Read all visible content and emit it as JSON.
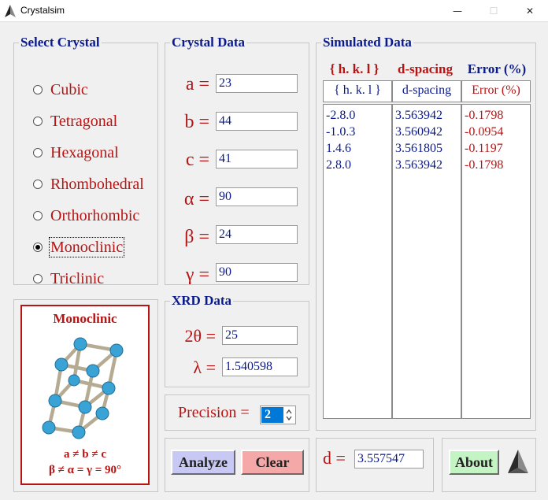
{
  "window": {
    "title": "Crystalsim",
    "minimize_glyph": "—",
    "maximize_glyph": "☐",
    "close_glyph": "✕"
  },
  "select_crystal": {
    "legend": "Select Crystal",
    "options": [
      "Cubic",
      "Tetragonal",
      "Hexagonal",
      "Rhombohedral",
      "Orthorhombic",
      "Monoclinic",
      "Triclinic"
    ],
    "selected": "Monoclinic"
  },
  "crystal_data": {
    "legend": "Crystal Data",
    "params": [
      {
        "label": "a =",
        "value": "23"
      },
      {
        "label": "b =",
        "value": "44"
      },
      {
        "label": "c =",
        "value": "41"
      },
      {
        "label": "α =",
        "value": "90"
      },
      {
        "label": "β =",
        "value": "24"
      },
      {
        "label": "γ =",
        "value": "90"
      }
    ]
  },
  "xrd_data": {
    "legend": "XRD Data",
    "two_theta_label": "2θ =",
    "two_theta_value": "25",
    "lambda_label": "λ =",
    "lambda_value": "1.540598"
  },
  "precision": {
    "label": "Precision =",
    "value": "2"
  },
  "buttons": {
    "analyze": "Analyze",
    "clear": "Clear",
    "about": "About"
  },
  "d_output": {
    "label": "d =",
    "value": "3.557547"
  },
  "preview": {
    "title": "Monoclinic",
    "line1": "a ≠ b ≠ c",
    "line2": "β ≠ α = γ = 90°"
  },
  "simulated_data": {
    "legend": "Simulated Data",
    "headers": [
      "{ h. k. l }",
      "d-spacing",
      "Error (%)"
    ],
    "subheaders": [
      "{ h. k. l }",
      "d-spacing",
      "Error (%)"
    ],
    "rows": [
      {
        "hkl": "-2.8.0",
        "d": "3.563942",
        "err": "-0.1798"
      },
      {
        "hkl": "-1.0.3",
        "d": "3.560942",
        "err": "-0.0954"
      },
      {
        "hkl": "1.4.6",
        "d": "3.561805",
        "err": "-0.1197"
      },
      {
        "hkl": "2.8.0",
        "d": "3.563942",
        "err": "-0.1798"
      }
    ]
  },
  "colors": {
    "blue": "#0a1a8c",
    "red": "#b81414",
    "analyze_bg": "#c8c8f4",
    "clear_bg": "#f4a8a8",
    "about_bg": "#c4f4c4"
  }
}
